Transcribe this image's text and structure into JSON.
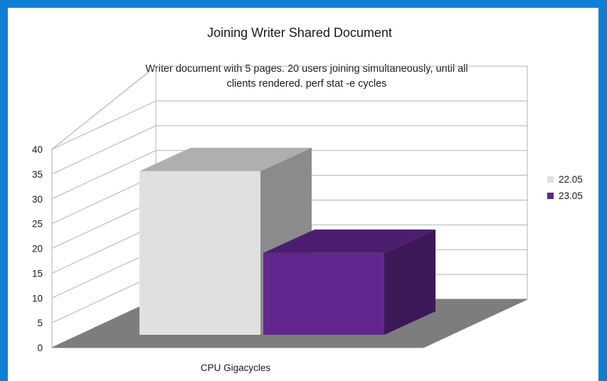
{
  "chart_data": {
    "type": "bar",
    "title": "Joining Writer Shared Document",
    "subtitle_lines": [
      "Writer document with 5 pages. 20 users joining simultaneously, until all",
      "clients rendered. perf stat -e cycles"
    ],
    "categories": [
      "CPU Gigacycles"
    ],
    "series": [
      {
        "name": "22.05",
        "values": [
          33
        ],
        "color": "#e0e0e0"
      },
      {
        "name": "23.05",
        "values": [
          16.5
        ],
        "color": "#63268f"
      }
    ],
    "yticks": [
      "0",
      "5",
      "10",
      "15",
      "20",
      "25",
      "30",
      "35",
      "40"
    ],
    "ylim": [
      0,
      40
    ],
    "grid": true,
    "three_d": true,
    "legend_position": "right"
  }
}
